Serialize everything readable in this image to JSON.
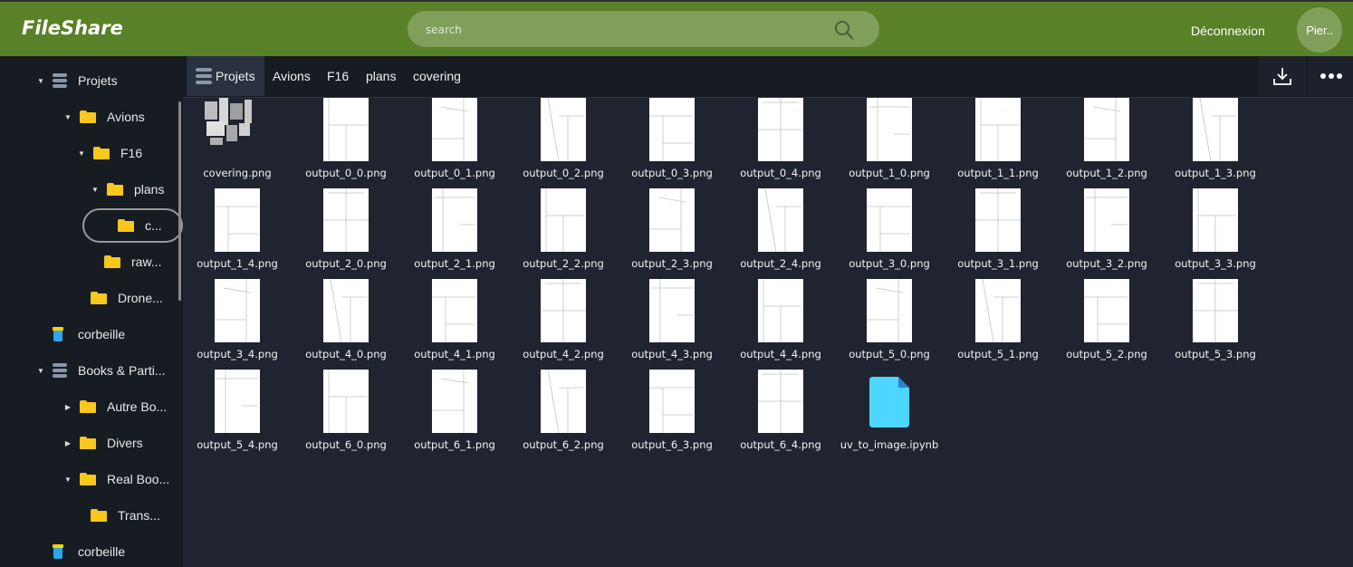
{
  "app": {
    "brand": "FileShare",
    "search_placeholder": "search",
    "logout": "Déconnexion",
    "user": "Pier.."
  },
  "sidebar": {
    "items": [
      {
        "label": "Projets",
        "icon": "database-icon",
        "caret": "expanded"
      },
      {
        "label": "Avions",
        "icon": "folder-icon",
        "caret": "expanded"
      },
      {
        "label": "F16",
        "icon": "folder-icon",
        "caret": "expanded"
      },
      {
        "label": "plans",
        "icon": "folder-icon",
        "caret": "expanded"
      },
      {
        "label": "c...",
        "icon": "folder-icon",
        "caret": "none",
        "selected": true
      },
      {
        "label": "raw...",
        "icon": "folder-icon",
        "caret": "none"
      },
      {
        "label": "Drone...",
        "icon": "folder-icon",
        "caret": "none"
      },
      {
        "label": "corbeille",
        "icon": "trash-icon",
        "caret": "none"
      },
      {
        "label": "Books & Parti...",
        "icon": "database-icon",
        "caret": "expanded"
      },
      {
        "label": "Autre Bo...",
        "icon": "folder-icon",
        "caret": "collapsed"
      },
      {
        "label": "Divers",
        "icon": "folder-icon",
        "caret": "collapsed"
      },
      {
        "label": "Real Boo...",
        "icon": "folder-icon",
        "caret": "expanded"
      },
      {
        "label": "Trans...",
        "icon": "folder-icon",
        "caret": "none"
      },
      {
        "label": "corbeille",
        "icon": "trash-icon",
        "caret": "none"
      }
    ]
  },
  "breadcrumb": [
    "Projets",
    "Avions",
    "F16",
    "plans",
    "covering"
  ],
  "toolbar": {
    "download_icon": "download-icon",
    "more_icon": "more-dots-icon"
  },
  "files": [
    "covering.png",
    "output_0_0.png",
    "output_0_1.png",
    "output_0_2.png",
    "output_0_3.png",
    "output_0_4.png",
    "output_1_0.png",
    "output_1_1.png",
    "output_1_2.png",
    "output_1_3.png",
    "output_1_4.png",
    "output_2_0.png",
    "output_2_1.png",
    "output_2_2.png",
    "output_2_3.png",
    "output_2_4.png",
    "output_3_0.png",
    "output_3_1.png",
    "output_3_2.png",
    "output_3_3.png",
    "output_3_4.png",
    "output_4_0.png",
    "output_4_1.png",
    "output_4_2.png",
    "output_4_3.png",
    "output_4_4.png",
    "output_5_0.png",
    "output_5_1.png",
    "output_5_2.png",
    "output_5_3.png",
    "output_5_4.png",
    "output_6_0.png",
    "output_6_1.png",
    "output_6_2.png",
    "output_6_3.png",
    "output_6_4.png",
    "uv_to_image.ipynb"
  ],
  "colors": {
    "header": "#588128",
    "sidebar": "#171b22",
    "main": "#1f2430",
    "folder": "#f8c81c",
    "notebook": "#4dd6ff"
  }
}
